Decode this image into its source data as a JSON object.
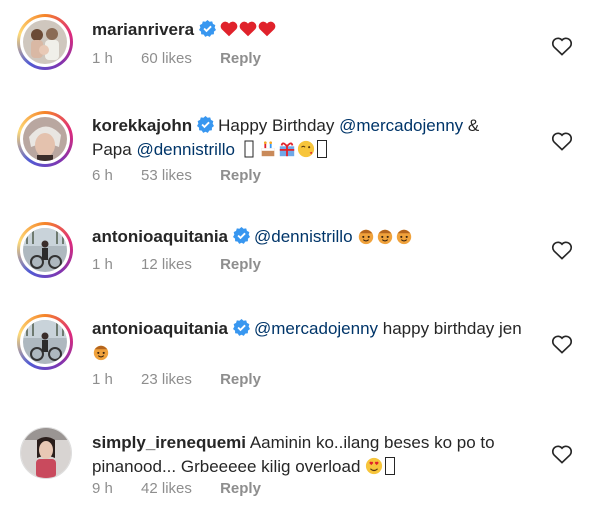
{
  "comments": [
    {
      "username": "marianrivera",
      "text_parts": [],
      "time": "1 h",
      "likes": "60 likes",
      "reply": "Reply"
    },
    {
      "username": "korekkajohn",
      "text_parts": [
        "Happy Birthday ",
        "@mercadojenny",
        " & Papa ",
        "@dennistrillo"
      ],
      "time": "6 h",
      "likes": "53 likes",
      "reply": "Reply"
    },
    {
      "username": "antonioaquitania",
      "text_parts": [
        "@dennistrillo"
      ],
      "time": "1 h",
      "likes": "12 likes",
      "reply": "Reply"
    },
    {
      "username": "antonioaquitania",
      "text_parts": [
        "@mercadojenny",
        " happy birthday jen"
      ],
      "time": "1 h",
      "likes": "23 likes",
      "reply": "Reply"
    },
    {
      "username": "simply_irenequemi",
      "text_parts": [
        "Aaminin ko..ilang beses ko po to pinanood... Grbeeeee  kilig overload"
      ],
      "time": "9 h",
      "likes": "42 likes",
      "reply": "Reply"
    }
  ],
  "colors": {
    "mention": "#003569",
    "verified": "#3897f0",
    "meta": "#8e8e8e",
    "heart_emoji": "#e0222b"
  }
}
